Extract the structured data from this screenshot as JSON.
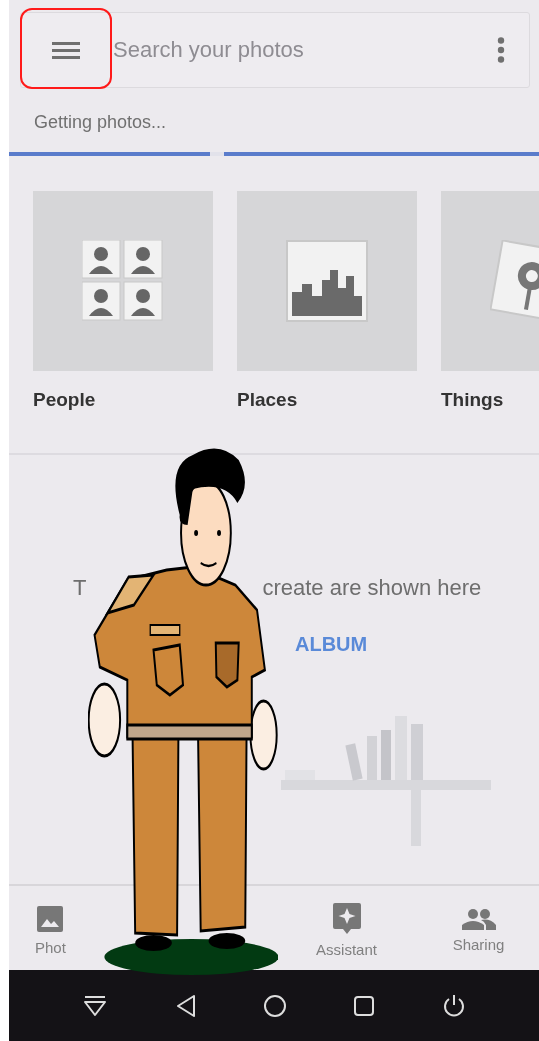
{
  "search": {
    "placeholder": "Search your photos"
  },
  "status": "Getting photos...",
  "progress": {
    "level": 0.38
  },
  "categories": [
    {
      "label": "People",
      "kind": "people"
    },
    {
      "label": "Places",
      "kind": "places"
    },
    {
      "label": "Things",
      "kind": "things"
    }
  ],
  "albums_empty": {
    "message_start": "T",
    "message_end": "create are shown here",
    "button": "ALBUM"
  },
  "bottom_nav": [
    {
      "label": "Phot",
      "kind": "photos"
    },
    {
      "label": "Assistant",
      "kind": "assistant"
    },
    {
      "label": "Sharing",
      "kind": "sharing"
    }
  ],
  "system_nav": [
    {
      "kind": "hide"
    },
    {
      "kind": "back"
    },
    {
      "kind": "home"
    },
    {
      "kind": "recents"
    },
    {
      "kind": "power"
    }
  ]
}
